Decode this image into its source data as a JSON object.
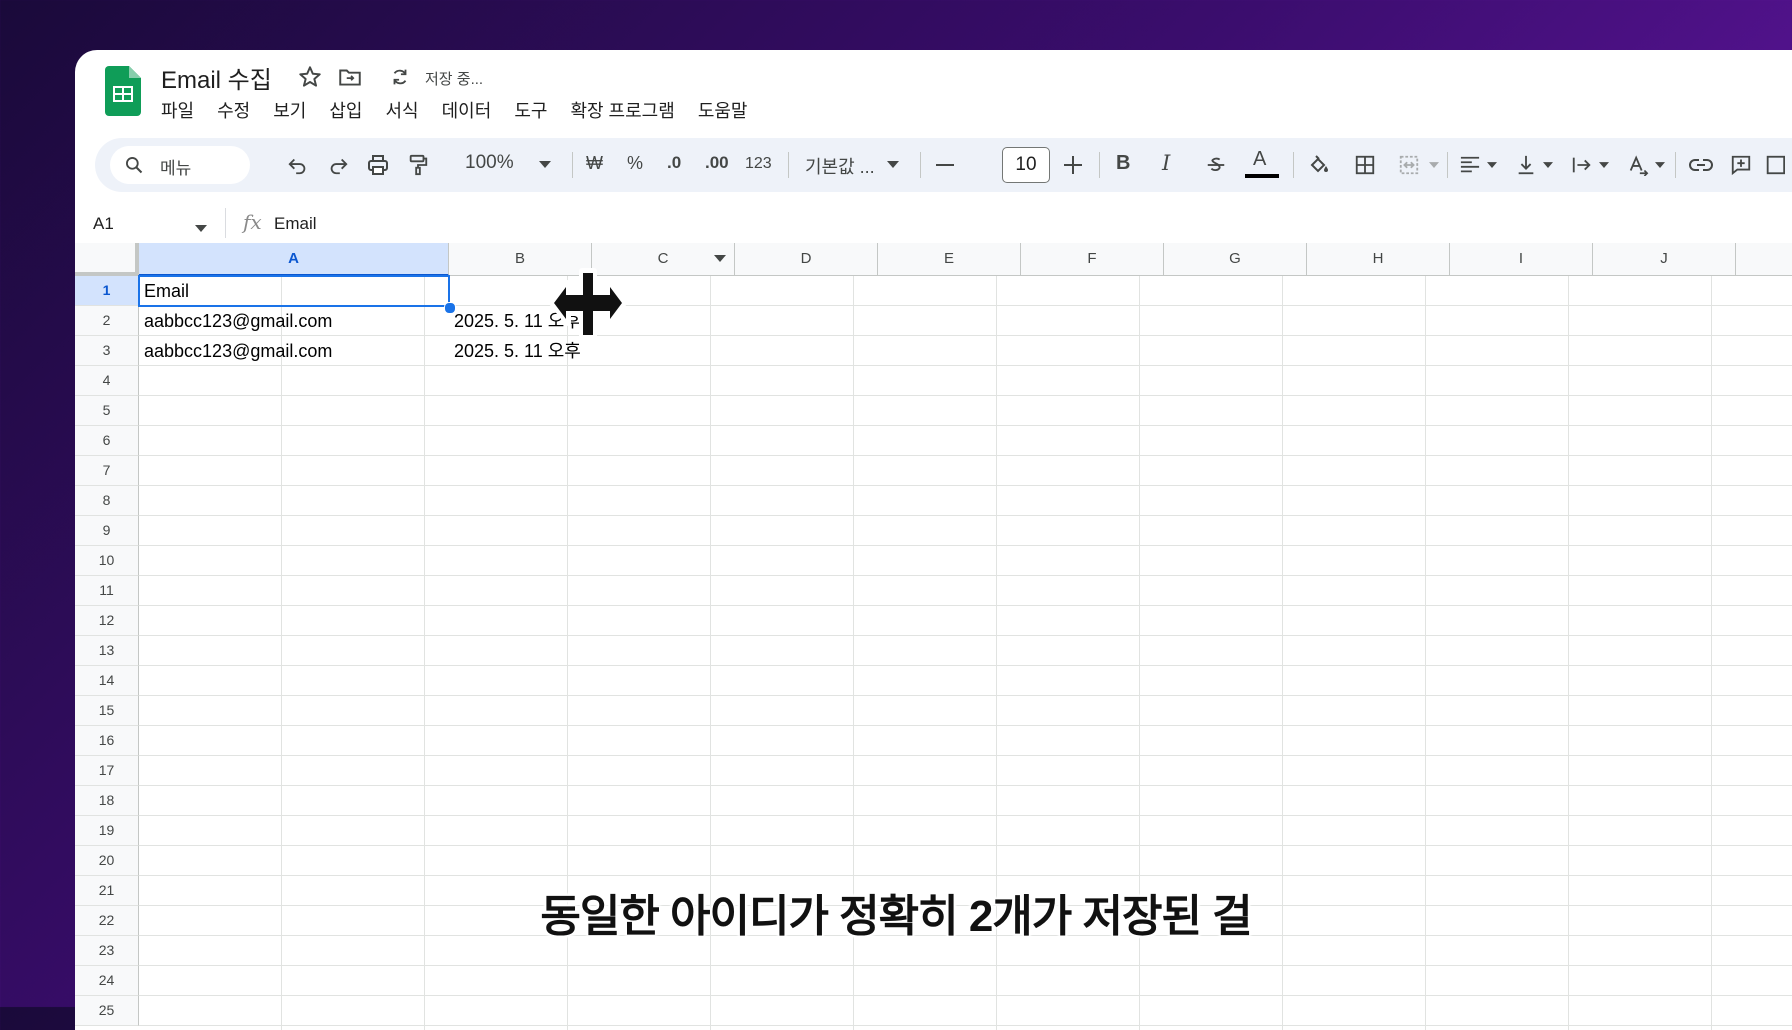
{
  "doc": {
    "title": "Email 수집",
    "saving_status": "저장 중..."
  },
  "menu": [
    "파일",
    "수정",
    "보기",
    "삽입",
    "서식",
    "데이터",
    "도구",
    "확장 프로그램",
    "도움말"
  ],
  "toolbar": {
    "search_label": "메뉴",
    "zoom": "100%",
    "currency": "₩",
    "percent": "%",
    "dec_decrease": ".0",
    "dec_increase": ".00",
    "number_format": "123",
    "font_name": "기본값 ...",
    "font_size": "10",
    "bold": "B",
    "italic": "I",
    "text_color_letter": "A"
  },
  "formula_bar": {
    "cell_ref": "A1",
    "fx": "fx",
    "value": "Email"
  },
  "grid": {
    "columns": [
      "A",
      "B",
      "C",
      "D",
      "E",
      "F",
      "G",
      "H",
      "I",
      "J"
    ],
    "rows": [
      "1",
      "2",
      "3",
      "4",
      "5",
      "6",
      "7",
      "8",
      "9",
      "10",
      "11",
      "12",
      "13",
      "14",
      "15",
      "16",
      "17",
      "18",
      "19",
      "20",
      "21",
      "22",
      "23",
      "24",
      "25"
    ],
    "cells": {
      "A1": "Email",
      "A2": "aabbcc123@gmail.com",
      "B2": "2025. 5. 11 오후",
      "A3": "aabbcc123@gmail.com",
      "B3": "2025. 5. 11 오후"
    }
  },
  "subtitle": "동일한 아이디가 정확히 2개가 저장된 걸",
  "colors": {
    "sheets_green": "#0f9d58",
    "selection_blue": "#1a73e8",
    "header_selected": "#d3e3fd"
  }
}
